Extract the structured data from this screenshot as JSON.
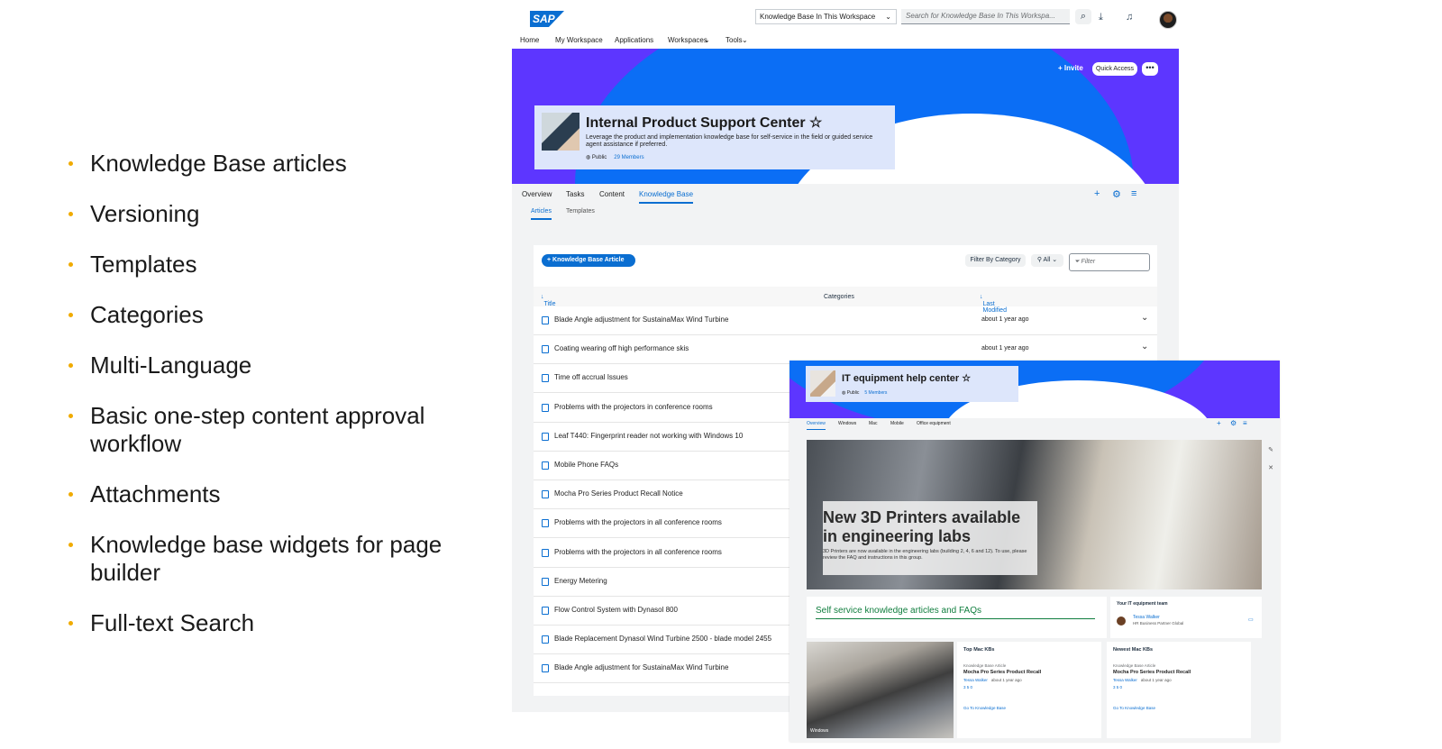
{
  "bullets": [
    "Knowledge Base articles",
    "Versioning",
    "Templates",
    "Categories",
    "Multi-Language",
    "Basic one-step content approval workflow",
    "Attachments",
    "Knowledge base widgets for page builder",
    "Full-text Search"
  ],
  "colors": {
    "bullet": "#f0ab00",
    "accent": "#0a6ed1",
    "banner_purple": "#5d36ff",
    "banner_blue": "#0b6ef5"
  },
  "shell": {
    "logo": "SAP",
    "scope": "Knowledge Base In This Workspace",
    "search_placeholder": "Search for Knowledge Base In This Workspa...",
    "icons": [
      "search-icon",
      "download-icon",
      "bell-icon",
      "avatar"
    ]
  },
  "topnav": [
    "Home",
    "My Workspace",
    "Applications",
    "Workspaces",
    "Tools"
  ],
  "workspace": {
    "invite": "+ Invite",
    "quick_access": "Quick Access",
    "more": "•••",
    "title": "Internal Product Support Center ☆",
    "description": "Leverage the product and implementation knowledge base for self-service in the field or guided service agent assistance if preferred.",
    "visibility": "Public",
    "members": "29 Members"
  },
  "tabs": [
    "Overview",
    "Tasks",
    "Content",
    "Knowledge Base"
  ],
  "subtabs": [
    "Articles",
    "Templates"
  ],
  "panel": {
    "add_button": "+ Knowledge Base Article",
    "filter_by_category": "Filter By Category",
    "all": "All",
    "filter_placeholder": "Filter",
    "col_title": "Title",
    "col_categories": "Categories",
    "col_modified": "Last Modified"
  },
  "rows": [
    {
      "title": "Blade Angle adjustment for SustainaMax Wind Turbine",
      "modified": "about 1 year ago"
    },
    {
      "title": "Coating wearing off high performance skis",
      "modified": "about 1 year ago"
    },
    {
      "title": "Time off accrual Issues",
      "modified": ""
    },
    {
      "title": "Problems with the projectors in conference rooms",
      "modified": ""
    },
    {
      "title": "Leaf T440: Fingerprint reader not working with Windows 10",
      "modified": ""
    },
    {
      "title": "Mobile Phone FAQs",
      "modified": ""
    },
    {
      "title": "Mocha Pro Series Product Recall Notice",
      "modified": ""
    },
    {
      "title": "Problems with the projectors in all conference rooms",
      "modified": ""
    },
    {
      "title": "Problems with the projectors in all conference rooms",
      "modified": ""
    },
    {
      "title": "Energy Metering",
      "modified": ""
    },
    {
      "title": "Flow Control System with Dynasol 800",
      "modified": ""
    },
    {
      "title": "Blade Replacement Dynasol Wind Turbine 2500 - blade model 2455",
      "modified": ""
    },
    {
      "title": "Blade Angle adjustment for SustainaMax Wind Turbine",
      "modified": ""
    }
  ],
  "overlay": {
    "title": "IT equipment help center ☆",
    "visibility": "Public",
    "members": "5 Members",
    "tabs": [
      "Overview",
      "Windows",
      "Mac",
      "Mobile",
      "Office equipment"
    ],
    "hero_title": "New 3D Printers available in engineering labs",
    "hero_text": "3D Printers are now available in the engineering labs (building 2, 4, 6 and 12). To use, please review the FAQ and instructions in this group.",
    "self_service": "Self service knowledge articles and FAQs",
    "team_header": "Your IT equipment team",
    "team_name": "Tessa Walker",
    "team_role": "HR Business Partner Global",
    "windows_label": "Windows",
    "widgets": [
      {
        "header": "Top Mac KBs",
        "kind": "Knowledge Base Article",
        "title": "Mocha Pro Series Product Recall",
        "author": "Tessa Walker",
        "age": "about 1 year ago",
        "stats": "3   5   0",
        "link": "Go To Knowledge Base"
      },
      {
        "header": "Newest Mac KBs",
        "kind": "Knowledge Base Article",
        "title": "Mocha Pro Series Product Recall",
        "author": "Tessa Walker",
        "age": "about 1 year ago",
        "stats": "3   5   0",
        "link": "Go To Knowledge Base"
      }
    ]
  }
}
